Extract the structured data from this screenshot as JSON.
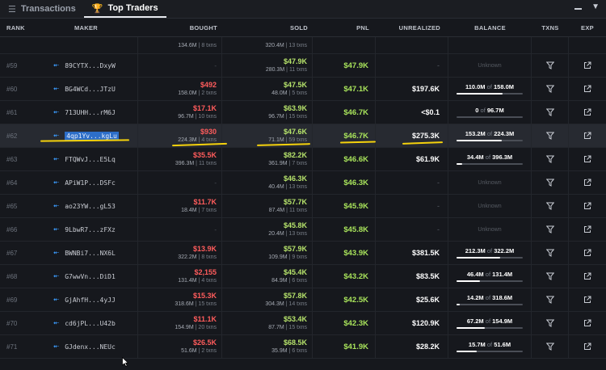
{
  "tabs": [
    {
      "label": "Transactions",
      "icon": "list-icon",
      "active": false
    },
    {
      "label": "Top Traders",
      "icon": "trophy-icon",
      "active": true
    }
  ],
  "columns": {
    "rank": "RANK",
    "maker": "MAKER",
    "bought": "BOUGHT",
    "sold": "SOLD",
    "pnl": "PNL",
    "unrealized": "UNREALIZED",
    "balance": "BALANCE",
    "txns": "TXNS",
    "exp": "EXP"
  },
  "partial_row": {
    "bought_sub": "134.6M",
    "bought_txns": "8 txns",
    "sold_sub": "320.4M",
    "sold_txns": "13 txns"
  },
  "balance_of": "of",
  "unknown_label": "Unknown",
  "rows": [
    {
      "rank": "#59",
      "maker": "89CYTX...DxyW",
      "bought": "",
      "bought_sub": "",
      "bought_txns": "",
      "bought_dash": "-",
      "sold": "$47.9K",
      "sold_sub": "280.3M",
      "sold_txns": "11 txns",
      "pnl": "$47.9K",
      "unrealized": "-",
      "bal_held": "",
      "bal_total": "",
      "bal_fill": 0,
      "unknown": true
    },
    {
      "rank": "#60",
      "maker": "BG4WCd...JTzU",
      "bought": "$492",
      "bought_sub": "158.0M",
      "bought_txns": "2 txns",
      "bought_dash": "",
      "sold": "$47.5K",
      "sold_sub": "48.0M",
      "sold_txns": "5 txns",
      "pnl": "$47.1K",
      "unrealized": "$197.6K",
      "bal_held": "110.0M",
      "bal_total": "158.0M",
      "bal_fill": 0.7,
      "unknown": false
    },
    {
      "rank": "#61",
      "maker": "713UHH...rM6J",
      "bought": "$17.1K",
      "bought_sub": "96.7M",
      "bought_txns": "10 txns",
      "bought_dash": "",
      "sold": "$63.9K",
      "sold_sub": "96.7M",
      "sold_txns": "15 txns",
      "pnl": "$46.7K",
      "unrealized": "<$0.1",
      "bal_held": "0",
      "bal_total": "96.7M",
      "bal_fill": 0,
      "unknown": false
    },
    {
      "rank": "#62",
      "maker": "4qp1Yv...kgLu",
      "bought": "$930",
      "bought_sub": "224.3M",
      "bought_txns": "4 txns",
      "bought_dash": "",
      "sold": "$47.6K",
      "sold_sub": "71.1M",
      "sold_txns": "59 txns",
      "pnl": "$46.7K",
      "unrealized": "$275.3K",
      "bal_held": "153.2M",
      "bal_total": "224.3M",
      "bal_fill": 0.68,
      "unknown": false
    },
    {
      "rank": "#63",
      "maker": "FTQWvJ...E5Lq",
      "bought": "$35.5K",
      "bought_sub": "396.3M",
      "bought_txns": "11 txns",
      "bought_dash": "",
      "sold": "$82.2K",
      "sold_sub": "361.9M",
      "sold_txns": "7 txns",
      "pnl": "$46.6K",
      "unrealized": "$61.9K",
      "bal_held": "34.4M",
      "bal_total": "396.3M",
      "bal_fill": 0.09,
      "unknown": false
    },
    {
      "rank": "#64",
      "maker": "APiW1P...DSFc",
      "bought": "",
      "bought_sub": "",
      "bought_txns": "",
      "bought_dash": "-",
      "sold": "$46.3K",
      "sold_sub": "40.4M",
      "sold_txns": "13 txns",
      "pnl": "$46.3K",
      "unrealized": "-",
      "bal_held": "",
      "bal_total": "",
      "bal_fill": 0,
      "unknown": true
    },
    {
      "rank": "#65",
      "maker": "ao23YW...gL53",
      "bought": "$11.7K",
      "bought_sub": "18.4M",
      "bought_txns": "7 txns",
      "bought_dash": "",
      "sold": "$57.7K",
      "sold_sub": "87.4M",
      "sold_txns": "11 txns",
      "pnl": "$45.9K",
      "unrealized": "-",
      "bal_held": "",
      "bal_total": "",
      "bal_fill": 0,
      "unknown": true
    },
    {
      "rank": "#66",
      "maker": "9LbwR7...zFXz",
      "bought": "",
      "bought_sub": "",
      "bought_txns": "",
      "bought_dash": "-",
      "sold": "$45.8K",
      "sold_sub": "20.4M",
      "sold_txns": "13 txns",
      "pnl": "$45.8K",
      "unrealized": "-",
      "bal_held": "",
      "bal_total": "",
      "bal_fill": 0,
      "unknown": true
    },
    {
      "rank": "#67",
      "maker": "BWNBi7...NX6L",
      "bought": "$13.9K",
      "bought_sub": "322.2M",
      "bought_txns": "8 txns",
      "bought_dash": "",
      "sold": "$57.9K",
      "sold_sub": "109.9M",
      "sold_txns": "9 txns",
      "pnl": "$43.9K",
      "unrealized": "$381.5K",
      "bal_held": "212.3M",
      "bal_total": "322.2M",
      "bal_fill": 0.66,
      "unknown": false
    },
    {
      "rank": "#68",
      "maker": "G7wwVn...DiD1",
      "bought": "$2,155",
      "bought_sub": "131.4M",
      "bought_txns": "4 txns",
      "bought_dash": "",
      "sold": "$45.4K",
      "sold_sub": "84.9M",
      "sold_txns": "6 txns",
      "pnl": "$43.2K",
      "unrealized": "$83.5K",
      "bal_held": "46.4M",
      "bal_total": "131.4M",
      "bal_fill": 0.35,
      "unknown": false
    },
    {
      "rank": "#69",
      "maker": "GjAhfH...4yJJ",
      "bought": "$15.3K",
      "bought_sub": "318.6M",
      "bought_txns": "15 txns",
      "bought_dash": "",
      "sold": "$57.8K",
      "sold_sub": "304.3M",
      "sold_txns": "14 txns",
      "pnl": "$42.5K",
      "unrealized": "$25.6K",
      "bal_held": "14.2M",
      "bal_total": "318.6M",
      "bal_fill": 0.05,
      "unknown": false
    },
    {
      "rank": "#70",
      "maker": "cd6jPL...U42b",
      "bought": "$11.1K",
      "bought_sub": "154.9M",
      "bought_txns": "20 txns",
      "bought_dash": "",
      "sold": "$53.4K",
      "sold_sub": "87.7M",
      "sold_txns": "15 txns",
      "pnl": "$42.3K",
      "unrealized": "$120.9K",
      "bal_held": "67.2M",
      "bal_total": "154.9M",
      "bal_fill": 0.43,
      "unknown": false
    },
    {
      "rank": "#71",
      "maker": "GJdenx...NEUc",
      "bought": "$26.5K",
      "bought_sub": "51.6M",
      "bought_txns": "2 txns",
      "bought_dash": "",
      "sold": "$68.5K",
      "sold_sub": "35.9M",
      "sold_txns": "6 txns",
      "pnl": "$41.9K",
      "unrealized": "$28.2K",
      "bal_held": "15.7M",
      "bal_total": "51.6M",
      "bal_fill": 0.3,
      "unknown": false
    }
  ],
  "highlight_row_index": 3,
  "colors": {
    "pnl": "#a8e35b",
    "bought": "#ff5c5c",
    "sold": "#b6e36b",
    "annotation": "#f5d20c",
    "maker_icon": "#3b9cff"
  }
}
